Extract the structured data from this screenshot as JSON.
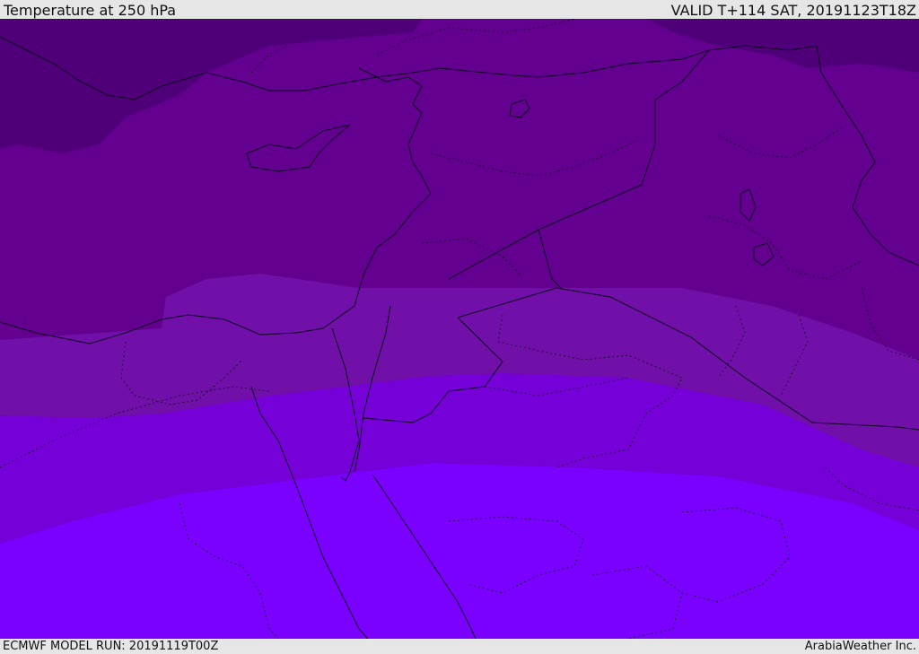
{
  "header": {
    "title": "Temperature at 250 hPa",
    "valid": "VALID T+114 SAT, 20191123T18Z"
  },
  "footer": {
    "model_run": "ECMWF MODEL RUN: 20191119T00Z",
    "brand": "ArabiaWeather Inc."
  },
  "colors": {
    "band_coldest": "#4f0079",
    "band_cold": "#630090",
    "band_mid": "#7010a8",
    "band_warm": "#7500d8",
    "band_warmest": "#7a00ff",
    "coast": "#0d0020"
  }
}
